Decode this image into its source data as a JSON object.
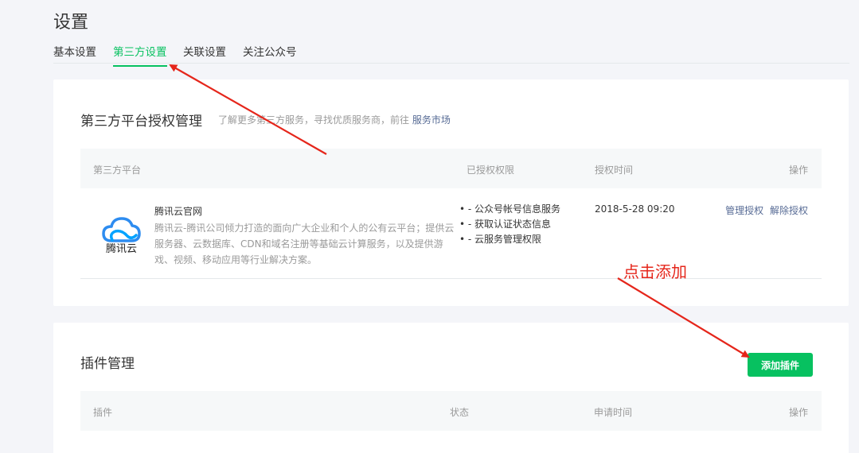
{
  "page": {
    "title": "设置"
  },
  "tabs": [
    {
      "label": "基本设置",
      "active": false
    },
    {
      "label": "第三方设置",
      "active": true
    },
    {
      "label": "关联设置",
      "active": false
    },
    {
      "label": "关注公众号",
      "active": false
    }
  ],
  "auth_section": {
    "title": "第三方平台授权管理",
    "subtitle": "了解更多第三方服务，寻找优质服务商，前往",
    "link": "服务市场",
    "columns": [
      "第三方平台",
      "已授权权限",
      "授权时间",
      "操作"
    ],
    "rows": [
      {
        "logo_icon": "tencent-cloud-logo-icon",
        "logo_text": "腾讯云",
        "name": "腾讯云官网",
        "description": "腾讯云-腾讯公司倾力打造的面向广大企业和个人的公有云平台；提供云服务器、云数据库、CDN和域名注册等基础云计算服务，以及提供游戏、视频、移动应用等行业解决方案。",
        "permissions": [
          "- 公众号帐号信息服务",
          "- 获取认证状态信息",
          "- 云服务管理权限"
        ],
        "time": "2018-5-28 09:20",
        "actions": [
          "管理授权",
          "解除授权"
        ]
      }
    ]
  },
  "plugin_section": {
    "title": "插件管理",
    "add_button": "添加插件",
    "columns": [
      "插件",
      "状态",
      "申请时间",
      "操作"
    ]
  },
  "annotation": {
    "text": "点击添加",
    "color": "#e5261b"
  },
  "colors": {
    "accent": "#07c160",
    "link": "#576b95",
    "annotation": "#e5261b"
  }
}
